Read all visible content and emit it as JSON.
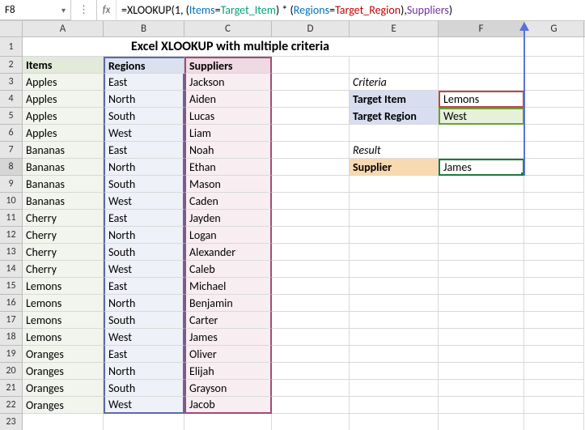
{
  "active_cell": "F8",
  "formula": {
    "prefix": "=XLOOKUP(1, (",
    "name1": "Items",
    "eq1": "=",
    "name2": "Target_Item",
    "mid": ") * (",
    "name3": "Regions",
    "eq2": "=",
    "name4": "Target_Region",
    "end1": "), ",
    "name5": "Suppliers",
    "end2": ")"
  },
  "columns": [
    "A",
    "B",
    "C",
    "D",
    "E",
    "F",
    "G"
  ],
  "title": "Excel XLOOKUP with multiple criteria",
  "headers": {
    "items": "Items",
    "regions": "Regions",
    "suppliers": "Suppliers"
  },
  "rows": [
    {
      "item": "Apples",
      "region": "East",
      "supplier": "Jackson"
    },
    {
      "item": "Apples",
      "region": "North",
      "supplier": "Aiden"
    },
    {
      "item": "Apples",
      "region": "South",
      "supplier": "Lucas"
    },
    {
      "item": "Apples",
      "region": "West",
      "supplier": "Liam"
    },
    {
      "item": "Bananas",
      "region": "East",
      "supplier": "Noah"
    },
    {
      "item": "Bananas",
      "region": "North",
      "supplier": "Ethan"
    },
    {
      "item": "Bananas",
      "region": "South",
      "supplier": "Mason"
    },
    {
      "item": "Bananas",
      "region": "West",
      "supplier": "Caden"
    },
    {
      "item": "Cherry",
      "region": "East",
      "supplier": "Jayden"
    },
    {
      "item": "Cherry",
      "region": "North",
      "supplier": "Logan"
    },
    {
      "item": "Cherry",
      "region": "South",
      "supplier": "Alexander"
    },
    {
      "item": "Cherry",
      "region": "West",
      "supplier": "Caleb"
    },
    {
      "item": "Lemons",
      "region": "East",
      "supplier": "Michael"
    },
    {
      "item": "Lemons",
      "region": "North",
      "supplier": "Benjamin"
    },
    {
      "item": "Lemons",
      "region": "South",
      "supplier": "Carter"
    },
    {
      "item": "Lemons",
      "region": "West",
      "supplier": "James"
    },
    {
      "item": "Oranges",
      "region": "East",
      "supplier": "Oliver"
    },
    {
      "item": "Oranges",
      "region": "North",
      "supplier": "Elijah"
    },
    {
      "item": "Oranges",
      "region": "South",
      "supplier": "Grayson"
    },
    {
      "item": "Oranges",
      "region": "West",
      "supplier": "Jacob"
    }
  ],
  "right": {
    "criteria_title": "Criteria",
    "target_item_label": "Target Item",
    "target_item_value": "Lemons",
    "target_region_label": "Target Region",
    "target_region_value": "West",
    "result_title": "Result",
    "supplier_label": "Supplier",
    "supplier_value": "James"
  }
}
